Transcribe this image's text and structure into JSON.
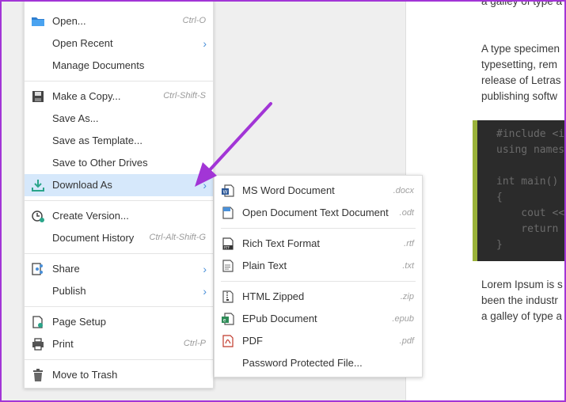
{
  "colors": {
    "accent": "#4a90d9",
    "highlight": "#d6e8fb",
    "annotation_arrow": "#a235d6",
    "code_border": "#9ab23a"
  },
  "document": {
    "line_top": "a galley of type a",
    "para1": [
      "A type specimen",
      "typesetting, rem",
      "release of Letras",
      "publishing softw"
    ],
    "code": [
      "#include <i",
      "using names",
      "",
      "int main()",
      "{",
      "    cout <<",
      "    return",
      "}"
    ],
    "para2": [
      "Lorem Ipsum is s",
      "been the industr",
      "a galley of type a"
    ]
  },
  "menu": {
    "items": [
      {
        "label": "Open...",
        "shortcut": "Ctrl-O",
        "icon": "folder-icon"
      },
      {
        "label": "Open Recent",
        "submenu": true
      },
      {
        "label": "Manage Documents"
      },
      {
        "label": "Make a Copy...",
        "shortcut": "Ctrl-Shift-S",
        "icon": "save-icon"
      },
      {
        "label": "Save As..."
      },
      {
        "label": "Save as Template..."
      },
      {
        "label": "Save to Other Drives"
      },
      {
        "label": "Download As",
        "submenu": true,
        "icon": "download-icon",
        "active": true
      },
      {
        "label": "Create Version...",
        "icon": "version-clock-icon"
      },
      {
        "label": "Document History",
        "shortcut": "Ctrl-Alt-Shift-G"
      },
      {
        "label": "Share",
        "submenu": true,
        "icon": "share-icon"
      },
      {
        "label": "Publish",
        "submenu": true
      },
      {
        "label": "Page Setup",
        "icon": "page-setup-icon"
      },
      {
        "label": "Print",
        "shortcut": "Ctrl-P",
        "icon": "print-icon"
      },
      {
        "label": "Move to Trash",
        "icon": "trash-icon"
      }
    ],
    "chevron": "›"
  },
  "submenu": {
    "items": [
      {
        "label": "MS Word Document",
        "ext": ".docx",
        "icon": "word-doc-icon"
      },
      {
        "label": "Open Document Text Document",
        "ext": ".odt",
        "icon": "odt-doc-icon"
      },
      {
        "label": "Rich Text Format",
        "ext": ".rtf",
        "icon": "rtf-icon"
      },
      {
        "label": "Plain Text",
        "ext": ".txt",
        "icon": "text-file-icon"
      },
      {
        "label": "HTML Zipped",
        "ext": ".zip",
        "icon": "zip-file-icon"
      },
      {
        "label": "EPub Document",
        "ext": ".epub",
        "icon": "epub-icon"
      },
      {
        "label": "PDF",
        "ext": ".pdf",
        "icon": "pdf-icon"
      },
      {
        "label": "Password Protected File..."
      }
    ]
  }
}
